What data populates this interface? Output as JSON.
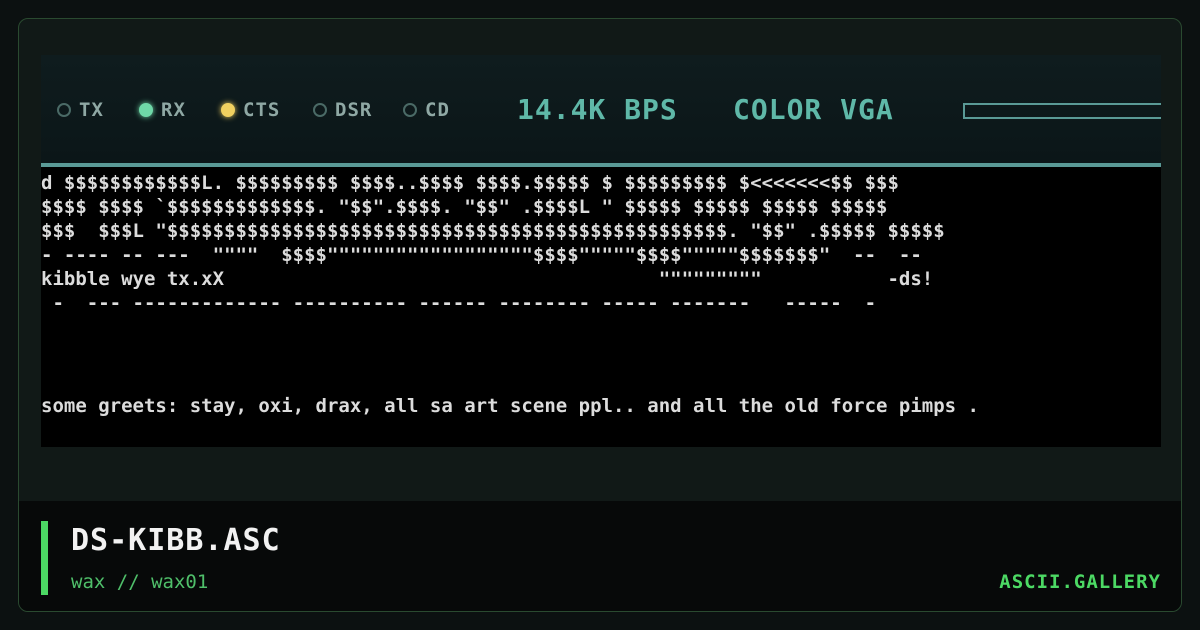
{
  "status": {
    "leds": [
      {
        "label": "TX",
        "state": "off"
      },
      {
        "label": "RX",
        "state": "green"
      },
      {
        "label": "CTS",
        "state": "yellow"
      },
      {
        "label": "DSR",
        "state": "off"
      },
      {
        "label": "CD",
        "state": "off"
      }
    ],
    "speed": "14.4K BPS",
    "mode": "COLOR VGA"
  },
  "art": {
    "lines": [
      "d $$$$$$$$$$$$L. $$$$$$$$$ $$$$..$$$$ $$$$.$$$$$ $ $$$$$$$$$ $<<<<<<<$$ $$$",
      "$$$$ $$$$ `$$$$$$$$$$$$$. \"$$\".$$$$. \"$$\" .$$$$L \" $$$$$ $$$$$ $$$$$ $$$$$",
      "$$$  $$$L \"$$$$$$$$$$$$$$$$$$$$$$$$$$$$$$$$$$$$$$$$$$$$$$$$$. \"$$\" .$$$$$ $$$$$",
      "- ---- -- ---  \"\"\"\"  $$$$\"\"\"\"\"\"\"\"\"\"\"\"\"\"\"\"\"\"$$$$\"\"\"\"\"$$$$\"\"\"\"\"$$$$$$$\"  --  --",
      "kibble wye tx.xX                                      \"\"\"\"\"\"\"\"\"           -ds!",
      " -  --- ------------- ---------- ------ -------- ----- -------   -----  -"
    ]
  },
  "greets": "some greets: stay, oxi, drax, all sa art scene ppl.. and all the old force pimps .",
  "footer": {
    "title": "DS-KIBB.ASC",
    "subtitle": "wax // wax01",
    "brand": "ASCII.GALLERY"
  },
  "colors": {
    "accent": "#4cd964",
    "status_text": "#5fb8a8",
    "led_green": "#6fd8a8",
    "led_yellow": "#f0d060"
  }
}
